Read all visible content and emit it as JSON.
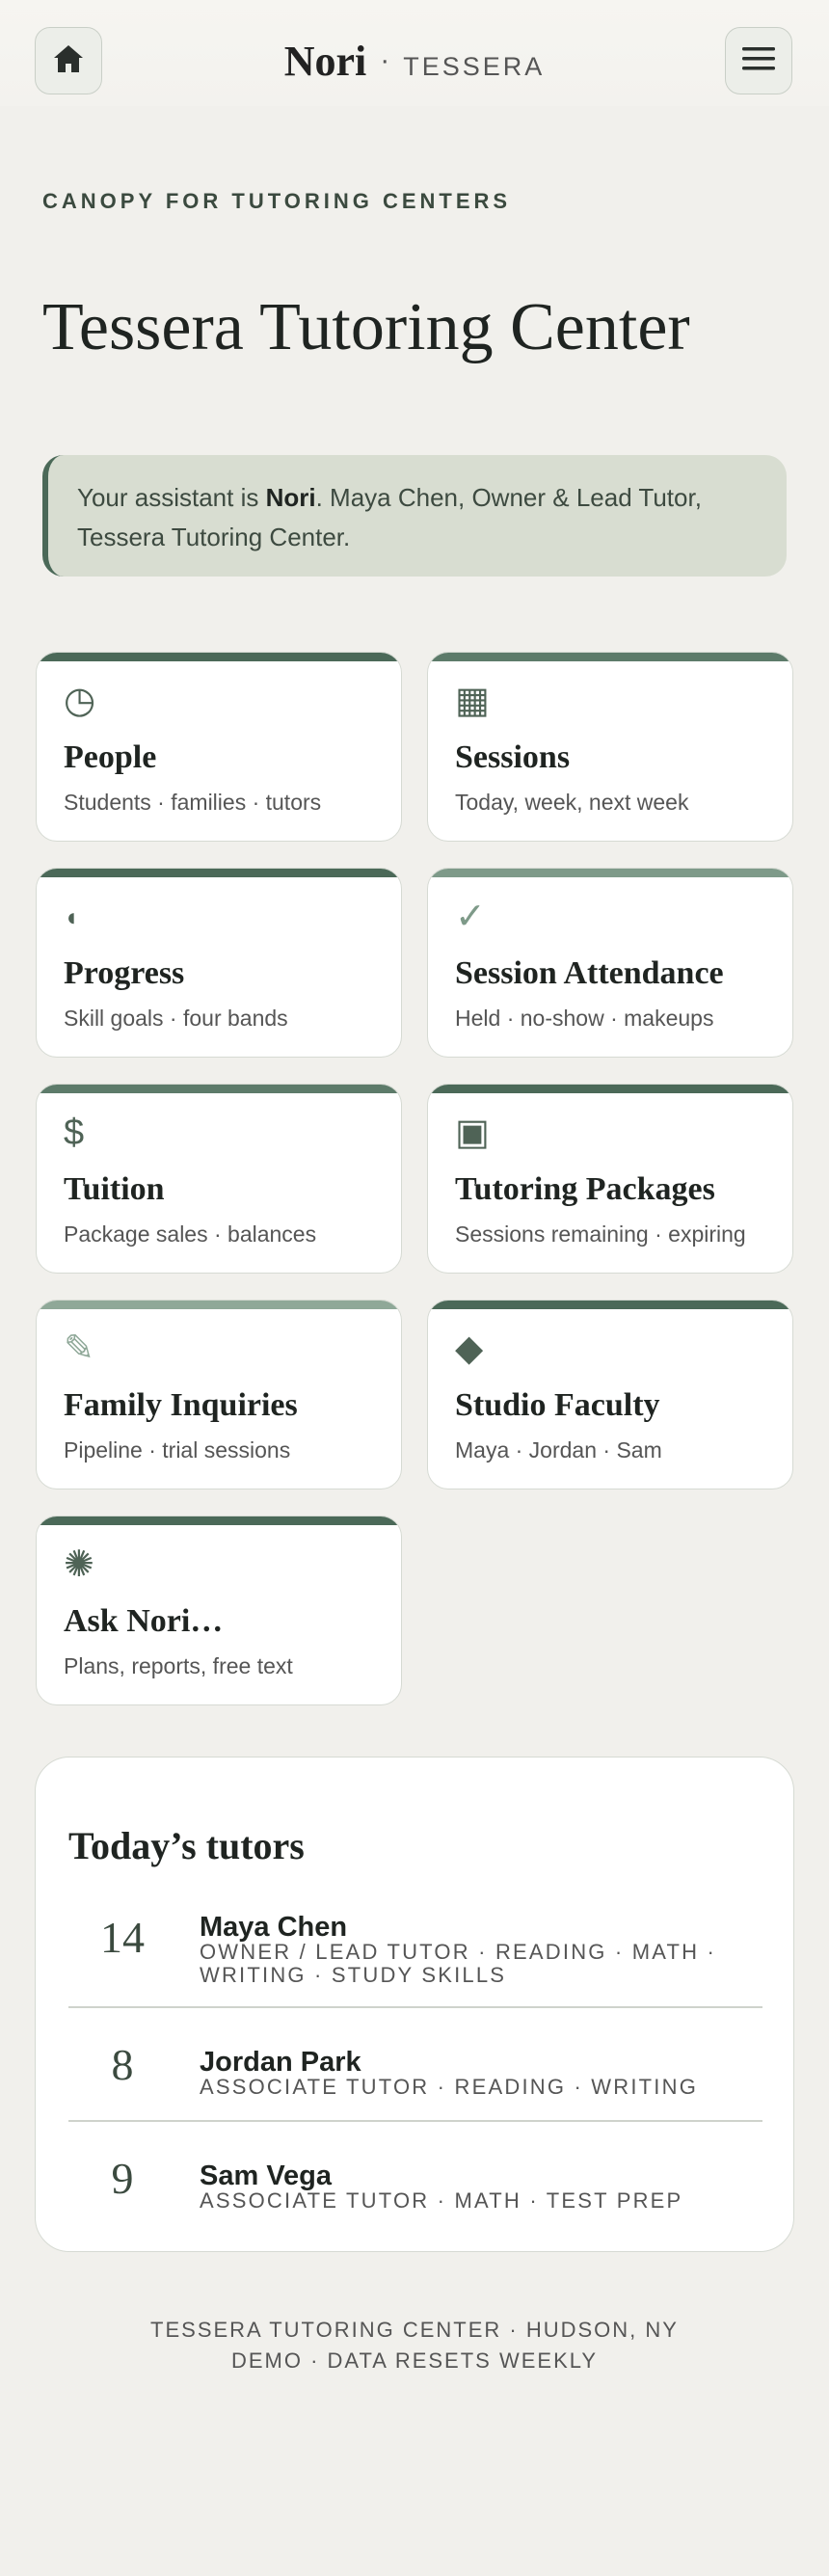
{
  "header": {
    "brand": "Nori",
    "separator": "·",
    "sub": "TESSERA",
    "home_icon": "home-icon",
    "menu_icon": "hamburger-menu-icon"
  },
  "eyebrow": "CANOPY FOR TUTORING CENTERS",
  "page_title": "Tessera Tutoring Center",
  "notice": {
    "prefix": "Your assistant is ",
    "assistant": "Nori",
    "suffix": ". Maya Chen, Owner & Lead Tutor, Tessera Tutoring Center."
  },
  "cards": [
    {
      "title": "People",
      "sub": "Students · families · tutors",
      "glyph": "◷",
      "icon": "clock-icon",
      "accent": "#4b6958"
    },
    {
      "title": "Sessions",
      "sub": "Today, week, next week",
      "glyph": "▦",
      "icon": "grid-icon",
      "accent": "#5d7b6a"
    },
    {
      "title": "Progress",
      "sub": "Skill goals · four bands",
      "glyph": "◖",
      "icon": "half-circle-icon",
      "accent": "#4b6958"
    },
    {
      "title": "Session Attendance",
      "sub": "Held · no-show · makeups",
      "glyph": "✓",
      "icon": "checkmark-icon",
      "accent": "#7e9a89"
    },
    {
      "title": "Tuition",
      "sub": "Package sales · balances",
      "glyph": "$",
      "icon": "dollar-icon",
      "accent": "#5d7b6a"
    },
    {
      "title": "Tutoring Packages",
      "sub": "Sessions remaining · expiring",
      "glyph": "▣",
      "icon": "square-icon",
      "accent": "#4b6958"
    },
    {
      "title": "Family Inquiries",
      "sub": "Pipeline · trial sessions",
      "glyph": "✎",
      "icon": "pencil-icon",
      "accent": "#8fa898"
    },
    {
      "title": "Studio Faculty",
      "sub": "Maya · Jordan · Sam",
      "glyph": "◆",
      "icon": "diamond-icon",
      "accent": "#4b6958"
    },
    {
      "title": "Ask Nori…",
      "sub": "Plans, reports, free text",
      "glyph": "✺",
      "icon": "sparkle-icon",
      "accent": "#4b6958"
    }
  ],
  "tutors_panel": {
    "title": "Today’s tutors",
    "tutors": [
      {
        "count": "14",
        "name": "Maya Chen",
        "role": "Owner / Lead Tutor · Reading · Math · Writing · Study Skills"
      },
      {
        "count": "8",
        "name": "Jordan Park",
        "role": "Associate Tutor · Reading · Writing"
      },
      {
        "count": "9",
        "name": "Sam Vega",
        "role": "Associate Tutor · Math · Test Prep"
      }
    ]
  },
  "footer": {
    "line1": "TESSERA TUTORING CENTER · HUDSON, NY",
    "line2": "DEMO · DATA RESETS WEEKLY"
  }
}
